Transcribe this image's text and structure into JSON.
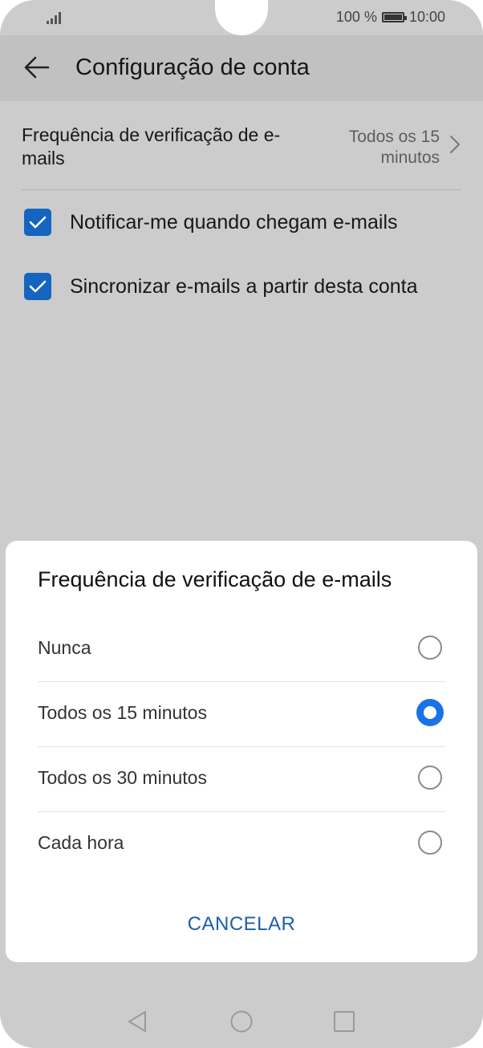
{
  "status_bar": {
    "battery_percent": "100 %",
    "time": "10:00",
    "icons": [
      "signal-icon",
      "battery-icon"
    ]
  },
  "app_bar": {
    "title": "Configuração de conta",
    "back_icon": "arrow-left-icon"
  },
  "settings": {
    "frequency": {
      "label": "Frequência de verificação de e-mails",
      "value": "Todos os 15 minutos"
    },
    "checkboxes": [
      {
        "label": "Notificar-me quando chegam e-mails",
        "checked": true
      },
      {
        "label": "Sincronizar e-mails a partir desta conta",
        "checked": true
      }
    ]
  },
  "dialog": {
    "title": "Frequência de verificação de e-mails",
    "options": [
      {
        "label": "Nunca",
        "selected": false
      },
      {
        "label": "Todos os 15 minutos",
        "selected": true
      },
      {
        "label": "Todos os 30 minutos",
        "selected": false
      },
      {
        "label": "Cada hora",
        "selected": false
      }
    ],
    "cancel_label": "CANCELAR"
  },
  "nav_bar": {
    "icons": [
      "back-triangle-icon",
      "home-circle-icon",
      "recents-square-icon"
    ]
  },
  "colors": {
    "accent": "#1a72e8",
    "checkbox": "#1565c0",
    "cancel_text": "#1d5fa8",
    "overlay_background": "#cccccc"
  }
}
